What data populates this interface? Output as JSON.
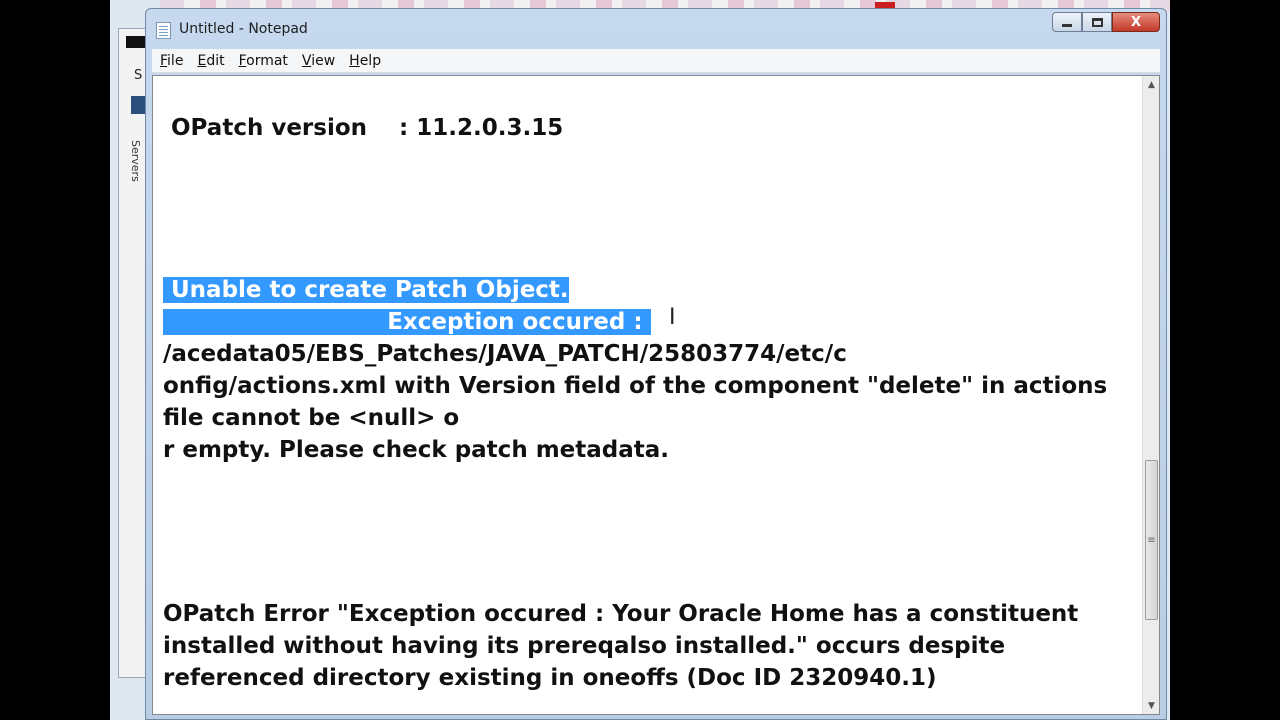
{
  "window": {
    "title": "Untitled - Notepad",
    "buttons": {
      "minimize": "",
      "maximize": "",
      "close": "X"
    }
  },
  "menubar": {
    "items": [
      {
        "label": "File",
        "accel": "F",
        "rest": "ile"
      },
      {
        "label": "Edit",
        "accel": "E",
        "rest": "dit"
      },
      {
        "label": "Format",
        "accel": "F",
        "rest": "ormat"
      },
      {
        "label": "View",
        "accel": "V",
        "rest": "iew"
      },
      {
        "label": "Help",
        "accel": "H",
        "rest": "elp"
      }
    ]
  },
  "background": {
    "side_label": "Servers",
    "side_letter": "S"
  },
  "document": {
    "lines": [
      {
        "text": " OPatch version    : 11.2.0.3.15",
        "selected": false
      },
      {
        "text": " Unable to create Patch Object.",
        "selected": true
      },
      {
        "text": "                            Exception occured : ",
        "selected": true
      },
      {
        "text": "/acedata05/EBS_Patches/JAVA_PATCH/25803774/etc/c",
        "selected": false
      },
      {
        "text": "onfig/actions.xml with Version field of the component \"delete\" in actions",
        "selected": false
      },
      {
        "text": "file cannot be <null> o",
        "selected": false
      },
      {
        "text": "r empty. Please check patch metadata.",
        "selected": false
      },
      {
        "text": "OPatch Error \"Exception occured : Your Oracle Home has a constituent",
        "selected": false
      },
      {
        "text": "installed without having its prereqalso installed.\" occurs despite",
        "selected": false
      },
      {
        "text": "referenced directory existing in oneoffs (Doc ID 2320940.1)",
        "selected": false
      }
    ]
  },
  "scrollbar": {
    "up_glyph": "▲",
    "down_glyph": "▼",
    "grip": "≡",
    "position": 0.6
  },
  "colors": {
    "selection": "#3399ff",
    "title_bar": "#c6d9ee",
    "close_button": "#c4392a"
  }
}
